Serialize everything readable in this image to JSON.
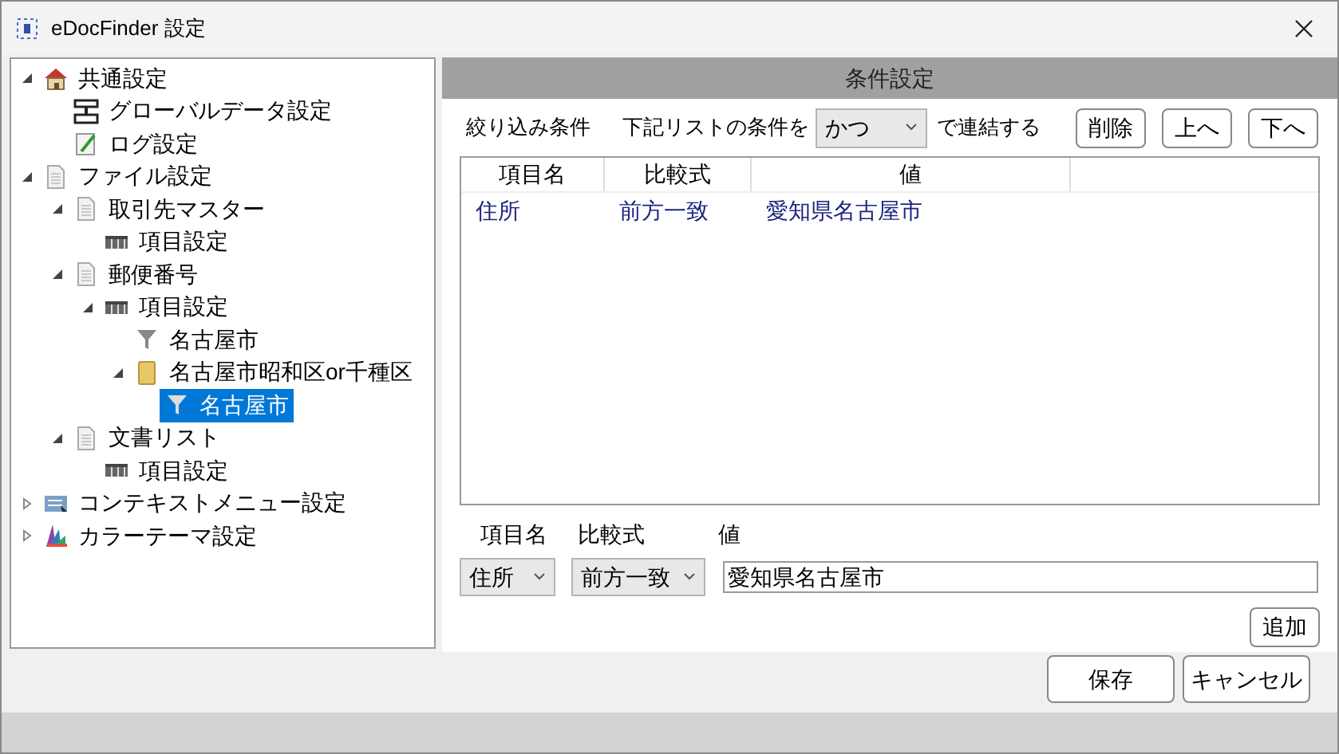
{
  "window": {
    "title": "eDocFinder 設定"
  },
  "tree": [
    {
      "label": "共通設定",
      "kind": "house",
      "expanded": true,
      "selected": false,
      "children": [
        {
          "label": "グローバルデータ設定",
          "kind": "global",
          "selected": false
        },
        {
          "label": "ログ設定",
          "kind": "log",
          "selected": false
        }
      ]
    },
    {
      "label": "ファイル設定",
      "kind": "document",
      "expanded": true,
      "selected": false,
      "children": [
        {
          "label": "取引先マスター",
          "kind": "document",
          "expanded": true,
          "selected": false,
          "children": [
            {
              "label": "項目設定",
              "kind": "table",
              "selected": false
            }
          ]
        },
        {
          "label": "郵便番号",
          "kind": "document",
          "expanded": true,
          "selected": false,
          "children": [
            {
              "label": "項目設定",
              "kind": "table",
              "expanded": true,
              "selected": false,
              "children": [
                {
                  "label": "名古屋市",
                  "kind": "filter",
                  "selected": false
                },
                {
                  "label": "名古屋市昭和区or千種区",
                  "kind": "folder",
                  "expanded": true,
                  "selected": false,
                  "children": [
                    {
                      "label": "名古屋市",
                      "kind": "filter",
                      "selected": true
                    }
                  ]
                }
              ]
            }
          ]
        },
        {
          "label": "文書リスト",
          "kind": "document",
          "expanded": true,
          "selected": false,
          "children": [
            {
              "label": "項目設定",
              "kind": "table",
              "selected": false
            }
          ]
        }
      ]
    },
    {
      "label": "コンテキストメニュー設定",
      "kind": "menu",
      "expanded": false,
      "selected": false
    },
    {
      "label": "カラーテーマ設定",
      "kind": "palette",
      "expanded": false,
      "selected": false
    }
  ],
  "panel": {
    "title": "条件設定",
    "filter_label": "絞り込み条件",
    "join_prefix": "下記リストの条件を",
    "join_value": "かつ",
    "join_suffix": "で連結する",
    "list_buttons": [
      "削除",
      "上へ",
      "下へ"
    ],
    "table": {
      "columns": [
        "項目名",
        "比較式",
        "値"
      ],
      "rows": [
        [
          "住所",
          "前方一致",
          "愛知県名古屋市"
        ]
      ]
    },
    "editor": {
      "labels": [
        "項目名",
        "比較式",
        "値"
      ],
      "field_select": "住所",
      "compare_select": "前方一致",
      "value": "愛知県名古屋市"
    },
    "add_button": "追加"
  },
  "footer_buttons": [
    "保存",
    "キャンセル"
  ]
}
